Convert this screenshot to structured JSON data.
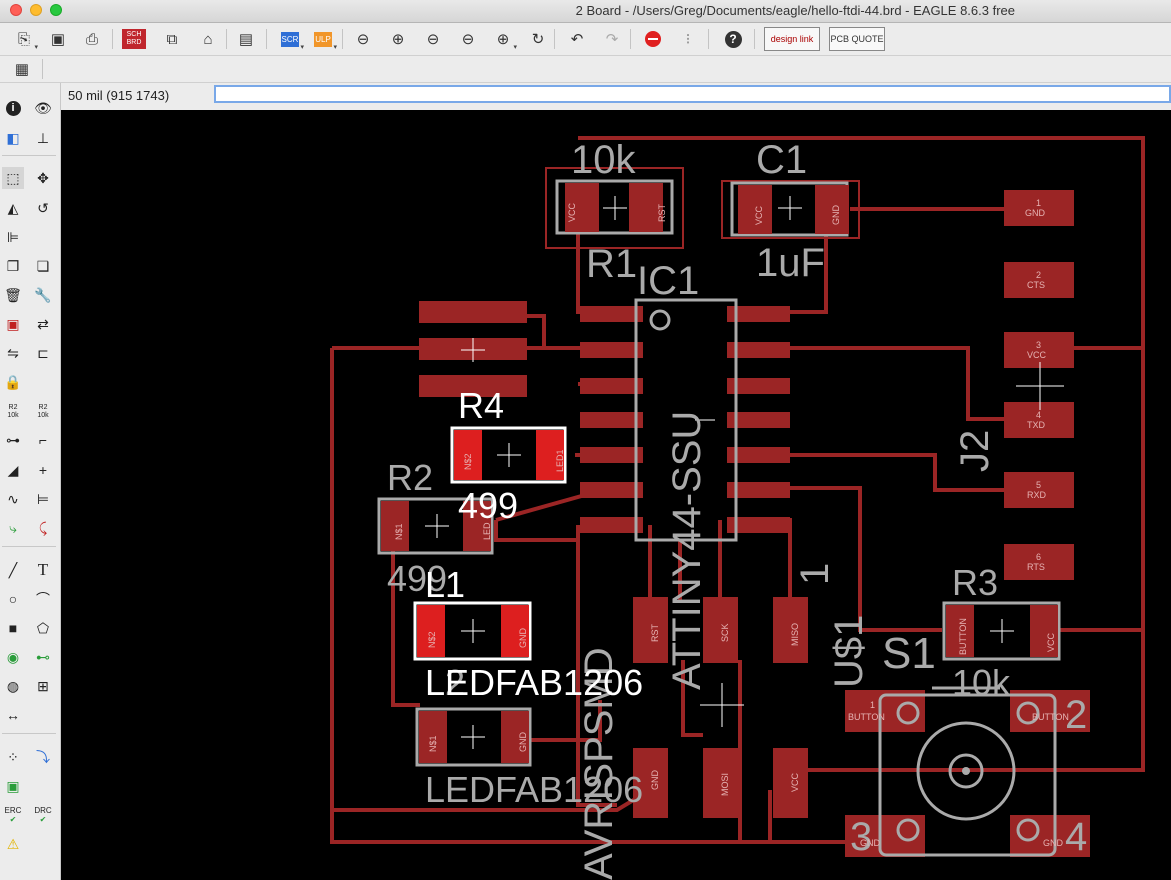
{
  "window": {
    "title": "2 Board - /Users/Greg/Documents/eagle/hello-ftdi-44.brd - EAGLE 8.6.3 free"
  },
  "toolbar": {
    "design_link": "design link",
    "pcb_quote": "PCB QUOTE",
    "sch_brd": "SCH BRD",
    "scr": "SCR",
    "ulp": "ULP"
  },
  "status": {
    "coords": "50 mil (915 1743)",
    "command": ""
  },
  "colors": {
    "board_bg": "#000000",
    "copper": "#9b2525",
    "pad_highlight": "#dd1f1f",
    "silkscreen": "#aaaaaa",
    "selection": "#ffffff"
  },
  "sidebar": {
    "r2_label": "R2",
    "r2_val": "10k",
    "r2b_label": "R2",
    "r2b_val": "10k",
    "erc": "ERC",
    "drc": "DRC"
  },
  "board": {
    "name_10k_top": "10k",
    "name_c1_top": "C1",
    "r1": "R1",
    "ic1": "IC1",
    "c1_value": "1uF",
    "r4": "R4",
    "r4_value": "499",
    "r2": "R2",
    "r2_value": "499",
    "l1": "L1",
    "l1_value": "LEDFAB1206",
    "l2": "L2",
    "l2_value": "LEDFAB1206",
    "ic_value": "ATTINY44-SSU",
    "avr": "AVRISPSMD",
    "j2": "J2",
    "one": "1",
    "us1": "U$1",
    "r3": "R3",
    "r3_value": "10k",
    "s1": "S1",
    "pad_labels": {
      "r1_left": "VCC",
      "r1_right": "RST",
      "r1_left_n": "2",
      "r1_right_n": "1",
      "c1_left": "VCC",
      "c1_right": "GND",
      "c1_left_n": "1",
      "c1_right_n": "2",
      "r4_left": "N$2",
      "r4_right": "LED1",
      "r4_right_n": "2",
      "r2_left": "N$1",
      "r2_right": "LED",
      "r2_left_n": "1",
      "r2_right_n": "2",
      "l1_left": "N$2",
      "l1_right": "GND",
      "l1_left_n": "1",
      "l1_right_n": "2",
      "l2_left": "N$1",
      "l2_right": "GND",
      "l2_left_n": "1",
      "l2_right_n": "2",
      "j2_1": "GND",
      "j2_2": "CTS",
      "j2_3": "VCC",
      "j2_4": "TXD",
      "j2_5": "RXD",
      "j2_6": "RTS",
      "j2_1n": "1",
      "j2_2n": "2",
      "j2_3n": "3",
      "j2_4n": "4",
      "j2_5n": "5",
      "j2_6n": "6",
      "isp_5": "RST",
      "isp_3": "SCK",
      "isp_1": "MISO",
      "isp_6": "GND",
      "isp_4": "MOSI",
      "isp_2": "VCC",
      "isp_5n": "5",
      "isp_3n": "3",
      "isp_1n": "1",
      "isp_6n": "6",
      "isp_4n": "4",
      "isp_2n": "2",
      "r3_left": "BUTTON",
      "r3_right": "VCC",
      "r3_left_n": "1",
      "r3_right_n": "2",
      "s1_1": "BUTTON",
      "s1_2": "BUTTON",
      "s1_3": "GND",
      "s1_4": "GND",
      "s1_1n": "1",
      "s1_2n": "2",
      "s1_3n": "3",
      "s1_4n": "4"
    }
  }
}
